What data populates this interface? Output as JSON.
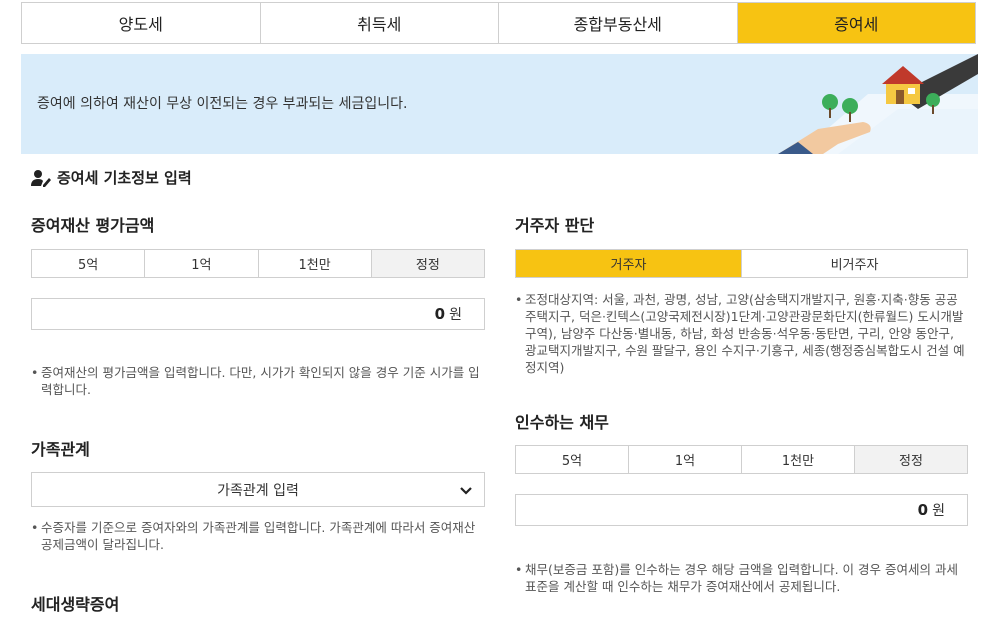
{
  "tabs": [
    {
      "label": "양도세"
    },
    {
      "label": "취득세"
    },
    {
      "label": "종합부동산세"
    },
    {
      "label": "증여세",
      "active": true
    }
  ],
  "banner": {
    "text": "증여에 의하여 재산이 무상 이전되는 경우 부과되는 세금입니다."
  },
  "section": {
    "title": "증여세 기초정보 입력",
    "icon": "user-edit-icon"
  },
  "asset": {
    "title": "증여재산 평가금액",
    "quick_buttons": [
      "5억",
      "1억",
      "1천만",
      "정정"
    ],
    "amount": "0",
    "unit": "원",
    "note": "증여재산의 평가금액을 입력합니다. 다만, 시가가 확인되지 않을 경우 기준 시가를 입력합니다."
  },
  "family": {
    "title": "가족관계",
    "select_value": "가족관계 입력",
    "note": "수증자를 기준으로 증여자와의 가족관계를 입력합니다. 가족관계에 따라서 증여재산 공제금액이 달라집니다."
  },
  "generation": {
    "title": "세대생략증여"
  },
  "residency": {
    "title": "거주자 판단",
    "options": [
      "거주자",
      "비거주자"
    ],
    "selected": "거주자",
    "note": "조정대상지역: 서울, 과천, 광명, 성남, 고양(삼송택지개발지구, 원흥·지축·향동 공공주택지구, 덕은·킨텍스(고양국제전시장)1단계·고양관광문화단지(한류월드) 도시개발구역), 남양주 다산동·별내동, 하남, 화성 반송동·석우동·동탄면, 구리, 안양 동안구, 광교택지개발지구, 수원 팔달구, 용인 수지구·기흥구, 세종(행정중심복합도시 건설 예정지역)"
  },
  "debt": {
    "title": "인수하는 채무",
    "quick_buttons": [
      "5억",
      "1억",
      "1천만",
      "정정"
    ],
    "amount": "0",
    "unit": "원",
    "note": "채무(보증금 포함)를 인수하는 경우 해당 금액을 입력합니다. 이 경우 증여세의 과세표준을 계산할 때 인수하는 채무가 증여재산에서 공제됩니다."
  },
  "colors": {
    "accent": "#f7c312",
    "banner_bg": "#d9ecfa"
  }
}
